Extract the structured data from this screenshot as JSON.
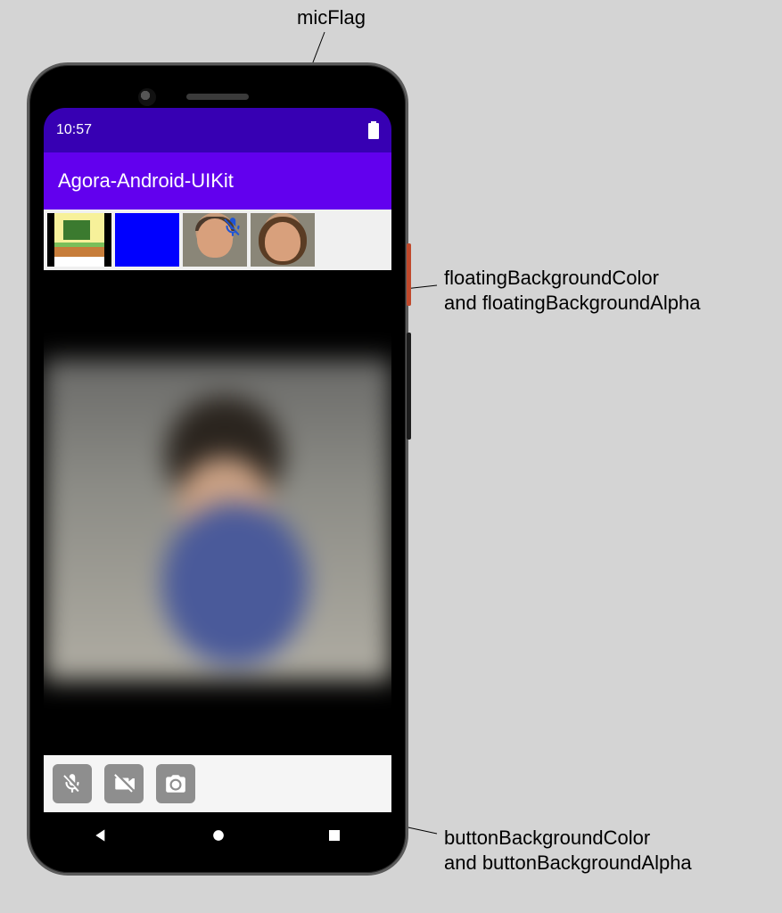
{
  "annotations": {
    "micFlag": "micFlag",
    "floating_line1": "floatingBackgroundColor",
    "floating_line2": "and floatingBackgroundAlpha",
    "button_line1": "buttonBackgroundColor",
    "button_line2": "and buttonBackgroundAlpha"
  },
  "status_bar": {
    "time": "10:57"
  },
  "app_bar": {
    "title": "Agora-Android-UIKit"
  },
  "floating_strip": {
    "backgroundColor": "#f0f0f0",
    "backgroundAlpha": 1.0,
    "tiles": [
      {
        "kind": "pixel-art"
      },
      {
        "kind": "solid-blue"
      },
      {
        "kind": "face-male",
        "micMuted": true
      },
      {
        "kind": "face-female"
      }
    ]
  },
  "button_bar": {
    "backgroundColor": "#f5f5f5",
    "backgroundAlpha": 1.0,
    "buttons": [
      {
        "name": "mic-off"
      },
      {
        "name": "video-off"
      },
      {
        "name": "switch-camera"
      }
    ]
  },
  "colors": {
    "statusBar": "#3700b3",
    "appBar": "#6200ee",
    "micFlag": "#1e54d6"
  }
}
